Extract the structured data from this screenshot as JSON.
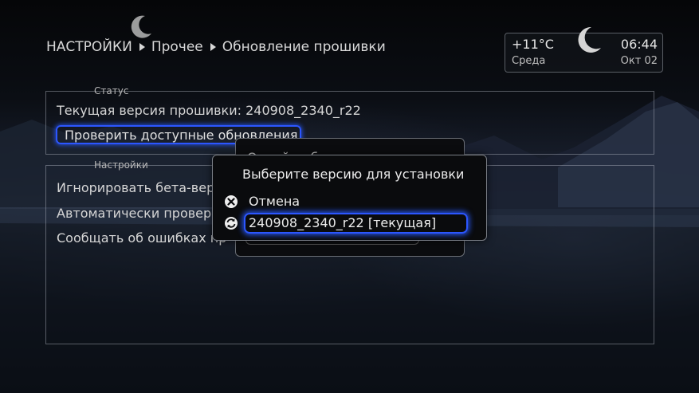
{
  "breadcrumb": {
    "items": [
      "НАСТРОЙКИ",
      "Прочее",
      "Обновление прошивки"
    ]
  },
  "weather": {
    "temperature": "+11°C",
    "time": "06:44",
    "day": "Среда",
    "date": "Окт 02"
  },
  "status_group": {
    "legend": "Статус",
    "firmware_version": "Текущая версия прошивки: 240908_2340_r22",
    "check_button": "Проверить доступные обновления"
  },
  "settings_group": {
    "legend": "Настройки",
    "options": [
      "Игнорировать бета-вер",
      "Автоматически проверя",
      "Сообщать об ошибках пр"
    ]
  },
  "background_dialog": {
    "title": "Онлайн-обновле"
  },
  "version_dialog": {
    "title": "Выберите версию для установки",
    "items": [
      {
        "label": "Отмена",
        "icon": "cancel-icon"
      },
      {
        "label": "240908_2340_r22 [текущая]",
        "icon": "refresh-icon"
      }
    ]
  },
  "colors": {
    "accent": "#2c56ff",
    "text": "#e6e6e6"
  }
}
